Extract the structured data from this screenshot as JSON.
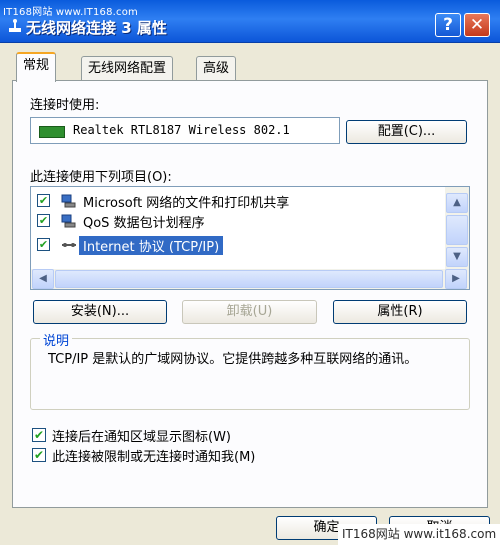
{
  "watermark_top": "IT168网站 www.IT168.com",
  "watermark_bottom": "IT168网站 www.it168.com",
  "window": {
    "title": "无线网络连接 3 属性",
    "help_label": "?",
    "close_label": "✕"
  },
  "tabs": [
    {
      "label": "常规",
      "active": true
    },
    {
      "label": "无线网络配置",
      "active": false
    },
    {
      "label": "高级",
      "active": false
    }
  ],
  "connect_using": {
    "label": "连接时使用:",
    "adapter": "Realtek RTL8187 Wireless 802.1",
    "configure_label": "配置(C)..."
  },
  "components": {
    "label": "此连接使用下列项目(O):",
    "items": [
      {
        "label": "Microsoft 网络的文件和打印机共享",
        "checked": true,
        "icon": "network-share-icon"
      },
      {
        "label": "QoS 数据包计划程序",
        "checked": true,
        "icon": "qos-icon"
      },
      {
        "label": "Internet 协议 (TCP/IP)",
        "checked": true,
        "icon": "protocol-icon",
        "selected": true
      }
    ]
  },
  "actions": {
    "install": "安装(N)...",
    "uninstall": "卸载(U)",
    "properties": "属性(R)"
  },
  "description": {
    "title": "说明",
    "text": "TCP/IP 是默认的广域网协议。它提供跨越多种互联网络的通讯。"
  },
  "options": [
    {
      "label": "连接后在通知区域显示图标(W)",
      "checked": true
    },
    {
      "label": "此连接被限制或无连接时通知我(M)",
      "checked": true
    }
  ],
  "footer": {
    "ok": "确定",
    "cancel": "取消"
  },
  "colors": {
    "title_bar": "#0a5bdc",
    "selection": "#316ac5",
    "group_title": "#0046d5"
  }
}
